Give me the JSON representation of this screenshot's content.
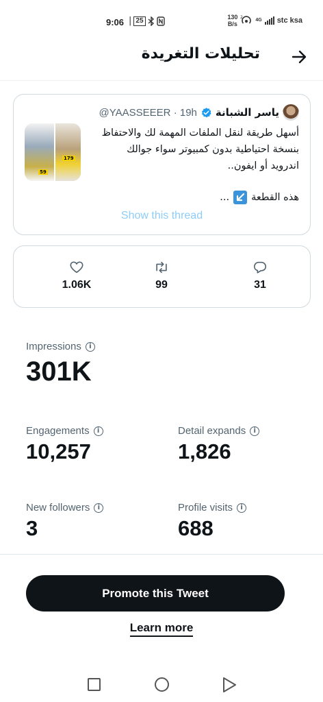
{
  "status_bar": {
    "time": "9:06",
    "battery": "25",
    "speed_value": "130",
    "speed_unit": "B/s",
    "network": "4G",
    "carrier": "stc ksa"
  },
  "header": {
    "title": "تحليلات التغريدة"
  },
  "tweet": {
    "author_name": "ياسر الشبانة",
    "handle": "@YAASSEEER",
    "time": "· 19h",
    "text_lines": [
      "أسهل طريقة لنقل الملفات المهمة لك والاحتفاظ",
      "بنسخة احتياطية بدون كمبيوتر سواء جوالك",
      "اندرويد أو ايفون.."
    ],
    "last_line_text": "هذه القطعة",
    "last_line_suffix": "...",
    "thumb_labels": [
      "59",
      "179"
    ],
    "show_thread": "Show this thread"
  },
  "metrics": {
    "likes": "1.06K",
    "retweets": "99",
    "replies": "31"
  },
  "stats": {
    "impressions": {
      "label": "Impressions",
      "value": "301K"
    },
    "engagements": {
      "label": "Engagements",
      "value": "10,257"
    },
    "detail_expands": {
      "label": "Detail expands",
      "value": "1,826"
    },
    "new_followers": {
      "label": "New followers",
      "value": "3"
    },
    "profile_visits": {
      "label": "Profile visits",
      "value": "688"
    }
  },
  "actions": {
    "promote": "Promote this Tweet",
    "learn_more": "Learn more"
  },
  "colors": {
    "verified": "#1d9bf0",
    "show_thread": "#8ecdf8",
    "button_bg": "#0f1419",
    "icon_gray": "#536471"
  },
  "icons": [
    "arrow-right-icon",
    "verified-icon",
    "heart-icon",
    "retweet-icon",
    "reply-icon",
    "info-icon",
    "nav-recent-icon",
    "nav-home-icon",
    "nav-back-icon"
  ]
}
